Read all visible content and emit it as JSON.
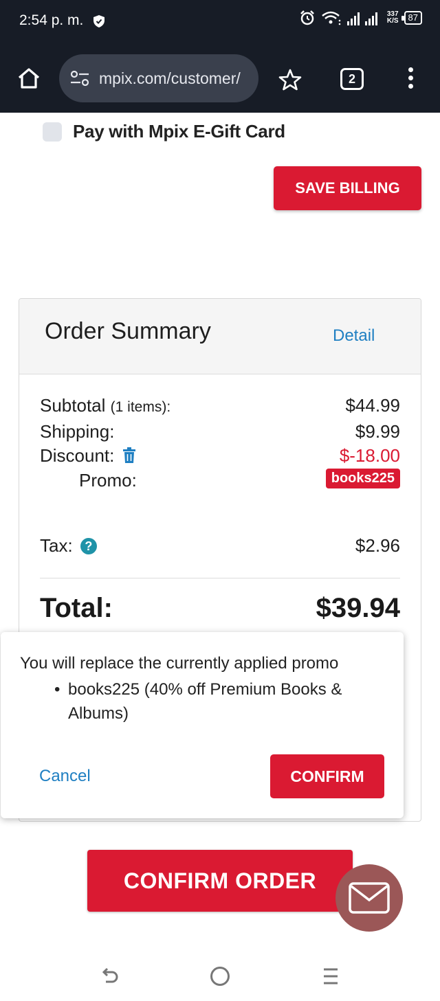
{
  "status_bar": {
    "time": "2:54 p. m.",
    "speed_value": "337",
    "speed_unit": "K/S",
    "battery": "87"
  },
  "browser": {
    "url": "mpix.com/customer/",
    "tab_count": "2"
  },
  "billing": {
    "gift_card_label": "Pay with Mpix E-Gift Card",
    "gift_card_checked": false,
    "save_button": "SAVE BILLING"
  },
  "summary": {
    "title": "Order Summary",
    "detail_link": "Detail",
    "subtotal_label": "Subtotal",
    "subtotal_items": "(1 items):",
    "subtotal_value": "$44.99",
    "shipping_label": "Shipping:",
    "shipping_value": "$9.99",
    "discount_label": "Discount:",
    "discount_value": "$-18.00",
    "promo_label": "Promo:",
    "promo_code": "books225",
    "tax_label": "Tax:",
    "tax_value": "$2.96",
    "total_label": "Total:",
    "total_value": "$39.94"
  },
  "dialog": {
    "message": "You will replace the currently applied promo",
    "items": [
      "books225 (40% off Premium Books & Albums)"
    ],
    "cancel": "Cancel",
    "confirm": "CONFIRM"
  },
  "confirm_order": "CONFIRM ORDER",
  "colors": {
    "brand_red": "#da1a32",
    "link_blue": "#1f7fc2",
    "chrome_dark": "#171c26",
    "fab": "#9b5757"
  },
  "icons": [
    "shield-icon",
    "alarm-icon",
    "wifi-icon",
    "signal-icon",
    "battery-icon",
    "home-icon",
    "tune-icon",
    "star-icon",
    "tabs-icon",
    "more-vert-icon",
    "trash-icon",
    "help-icon",
    "mail-icon",
    "back-icon",
    "circle-home-icon",
    "recents-icon"
  ]
}
